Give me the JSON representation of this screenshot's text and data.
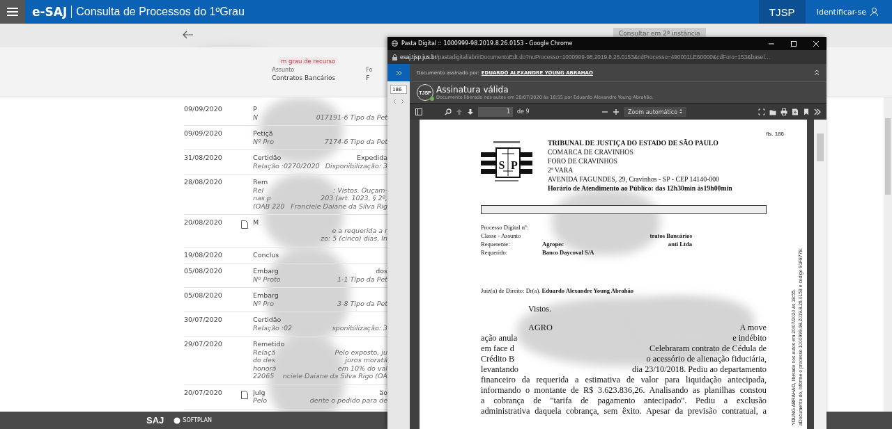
{
  "header": {
    "brand": "e-SAJ",
    "title": "Consulta de Processos do 1ºGrau",
    "court": "TJSP",
    "login": "Identificar-se"
  },
  "subbar": {
    "button": "Consultar em 2ª instância"
  },
  "process_info": {
    "tag": "m grau de recurso",
    "fields": [
      {
        "label": "Assunto",
        "value": "Contratos Bancários"
      },
      {
        "label": "Fo",
        "value": "F"
      }
    ]
  },
  "movements": [
    {
      "date": "09/09/2020",
      "doc": false,
      "lines": [
        {
          "start": "P"
        },
        {
          "start": "N",
          "end": "017191-6 Tipo da Pet"
        }
      ]
    },
    {
      "date": "09/09/2020",
      "doc": false,
      "lines": [
        {
          "start": "Petiçã"
        },
        {
          "start": "Nº Pro",
          "end": "7174-6 Tipo da Pet"
        }
      ]
    },
    {
      "date": "31/08/2020",
      "doc": false,
      "lines": [
        {
          "start": "Certidão",
          "end": "Expedida"
        },
        {
          "start": "Relação :0270/2020",
          "end": "Disponibilização: 3"
        }
      ]
    },
    {
      "date": "28/08/2020",
      "doc": false,
      "lines": [
        {
          "start": "Rem"
        },
        {
          "start": "Rel",
          "end": ": Vistos. Ouçam-"
        },
        {
          "start": "nas p",
          "end": "203 (art. 1023, § 2º,"
        },
        {
          "start": "(OAB 220",
          "end": "Franciele Daiane da Silva Rig"
        }
      ]
    },
    {
      "date": "20/08/2020",
      "doc": true,
      "lines": [
        {
          "start": "M"
        },
        {
          "end": "e a requerida a r"
        },
        {
          "end": "zo: 5 (cinco) dias. In"
        }
      ]
    },
    {
      "date": "19/08/2020",
      "doc": false,
      "lines": [
        {
          "start": "Conclus"
        }
      ]
    },
    {
      "date": "05/08/2020",
      "doc": false,
      "lines": [
        {
          "start": "Embarg",
          "end": "dos"
        },
        {
          "start": "Nº Proto",
          "end": "1-1 Tipo da Pet"
        }
      ]
    },
    {
      "date": "05/08/2020",
      "doc": false,
      "lines": [
        {
          "start": "Embarg"
        },
        {
          "start": "Nº Pro",
          "end": "3-8 Tipo da Pet"
        }
      ]
    },
    {
      "date": "30/07/2020",
      "doc": false,
      "lines": [
        {
          "start": "Certidão"
        },
        {
          "start": "Relação :02",
          "end": "sponibilização: 3"
        }
      ]
    },
    {
      "date": "29/07/2020",
      "doc": false,
      "lines": [
        {
          "start": "Remetido"
        },
        {
          "start": "Relaçã",
          "end": "Pelo exposto, ju"
        },
        {
          "start": "do des",
          "end": "juros moratá"
        },
        {
          "start": "honorá",
          "end": "em 10% do val"
        },
        {
          "start": "22065",
          "end": "nciele Daiane da Silva Rigo (OA"
        }
      ]
    },
    {
      "date": "20/07/2020",
      "doc": true,
      "lines": [
        {
          "start": "Julg",
          "end": "ão"
        },
        {
          "start": "Pelo",
          "end": "dente o pedido para de"
        }
      ]
    }
  ],
  "footer": {
    "logo": "SAJ",
    "company": "SOFTPLAN"
  },
  "viewer": {
    "window_title": "Pasta Digital :: 1000999-98.2019.8.26.0153 - Google Chrome",
    "url_host": "esaj.tjsp.jus.br",
    "url_path": "/pastadigital/abrirDocumentoEdt.do?nuProcesso=1000999-98.2019.8.26.0153&cdProcesso=490001LE60000&cdForo=153&basel…",
    "page_box": "186",
    "signed_label": "Documento assinado por:",
    "signer": "EDUARDO ALEXANDRE YOUNG ABRAHAO",
    "badge": "TJSP",
    "valid": true,
    "signature_status": "Assinatura válida",
    "signature_note": "Documento liberado nos autos em 20/07/2020 às 18:55 por Eduardo Alexandre Young Abrahão.",
    "page_number": "1",
    "page_count": "de 9",
    "zoom": "Zoom automático"
  },
  "document": {
    "folio": "fls. 186",
    "seal_letters": [
      "S",
      "P"
    ],
    "header_lines": [
      {
        "text": "TRIBUNAL DE JUSTIÇA DO ESTADO DE SÃO PAULO",
        "bold": true
      },
      {
        "text": "COMARCA DE CRAVINHOS",
        "bold": false
      },
      {
        "text": "FORO DE CRAVINHOS",
        "bold": false
      },
      {
        "text": "2ª VARA",
        "bold": false
      },
      {
        "text": "AVENIDA FAGUNDES, 29, Cravinhos - SP - CEP 14140-000",
        "bold": false
      },
      {
        "text": "Horário de Atendimento ao Público: das 12h30min às19h00min",
        "bold": true
      }
    ],
    "fields": [
      {
        "label": "Processo Digital nº:"
      },
      {
        "label": "Classe - Assunto",
        "end": "tratos Bancários"
      },
      {
        "label": "Requerente:",
        "start": "Agropec",
        "end": "anti Ltda"
      },
      {
        "label": "Requerido:",
        "start": "Banco Daycoval S/A"
      }
    ],
    "judge": "Juiz(a) de Direito: Dr(a). **Eduardo Alexandre Young Abrahão**",
    "greeting": "Vistos.",
    "paragraph": [
      {
        "start": "AGRO",
        "end": "A move"
      },
      {
        "start": "ação anula",
        "end": "e indébito"
      },
      {
        "start": "em face d",
        "end": "Celebraram contrato de Cédula de"
      },
      {
        "start": "Crédito B",
        "end": "o acessório de alienação fiduciária,"
      },
      {
        "start": "levantando",
        "end": "dia 23/10/2018. Pediu ao departamento"
      },
      {
        "text": "financeiro da requerida a estimativa de valor para liquidação antecipada,"
      },
      {
        "text": "informando o montante de R$ 3.623.836,26. Analisando as planilhas constou"
      },
      {
        "text": "a cobrança de \"tarifa de pagamento antecipado\". Pediu a exclusão"
      },
      {
        "text": "administrativa daquela cobrança, sem êxito. Apesar da previsão contratual, a"
      }
    ],
    "stamp_lines": [
      "YOUNG ABRAHAO, liberado nos autos em 20/07/2020 às 18:55.",
      "aDocumento do, informe o processo 1000999-98.2019.8.26.0153 e código 91F8778."
    ]
  }
}
